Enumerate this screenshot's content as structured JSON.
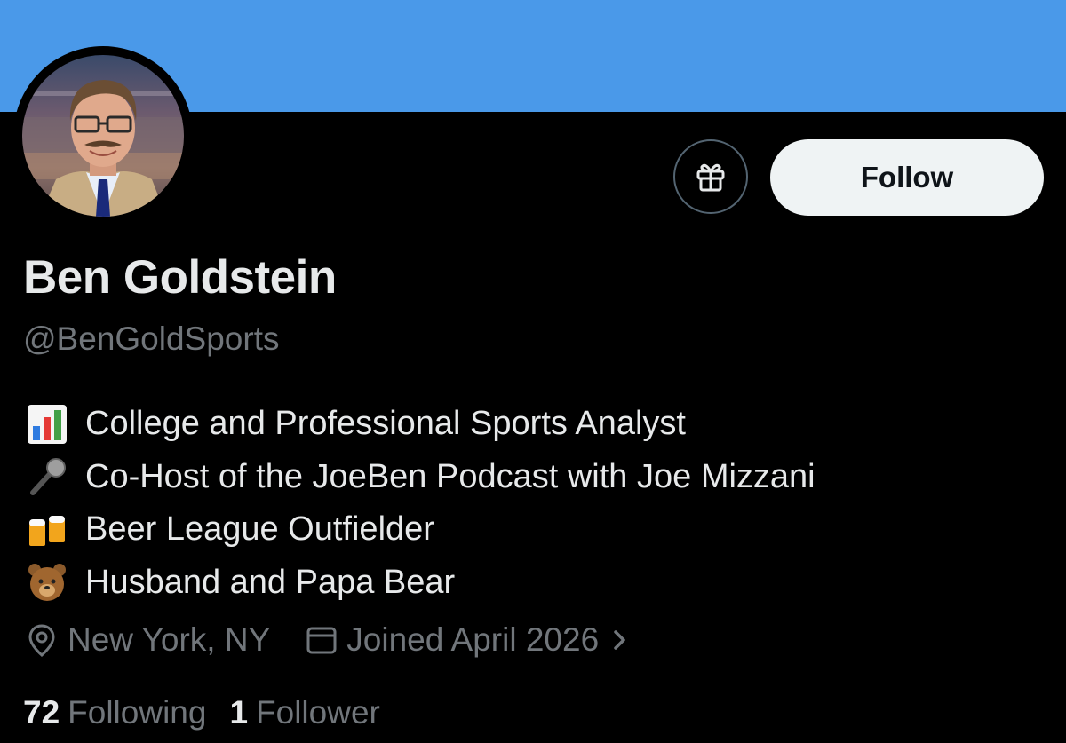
{
  "profile": {
    "display_name": "Ben Goldstein",
    "handle": "@BenGoldSports",
    "banner_color": "#4a99e9"
  },
  "actions": {
    "gift_icon": "gift-icon",
    "follow_label": "Follow"
  },
  "bio": [
    {
      "emoji": "bar-chart-emoji",
      "text": "College and Professional Sports Analyst"
    },
    {
      "emoji": "microphone-emoji",
      "text": "Co-Host of the JoeBen Podcast with Joe Mizzani"
    },
    {
      "emoji": "beer-mugs-emoji",
      "text": "Beer League Outfielder"
    },
    {
      "emoji": "bear-face-emoji",
      "text": "Husband and Papa Bear"
    }
  ],
  "meta": {
    "location": "New York, NY",
    "joined": "Joined April 2026"
  },
  "stats": {
    "following_count": "72",
    "following_label": "Following",
    "followers_count": "1",
    "followers_label": "Follower"
  }
}
